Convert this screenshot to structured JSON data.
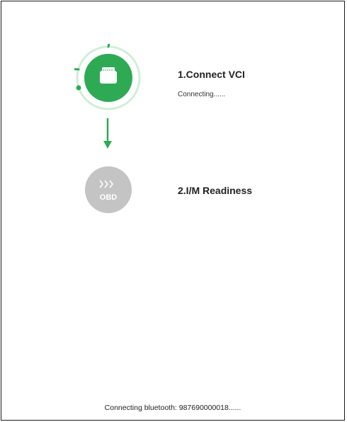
{
  "steps": [
    {
      "title": "1.Connect VCI",
      "status": "Connecting......",
      "icon": "vci-connector-icon",
      "state": "active",
      "color": "#2eaa55"
    },
    {
      "title": "2.I/M Readiness",
      "icon": "obd-icon",
      "icon_text": "OBD",
      "state": "pending",
      "color": "#c4c4c4"
    }
  ],
  "footer": {
    "status": "Connecting bluetooth: 987690000018......"
  },
  "colors": {
    "accent": "#2eaa55",
    "accent_light": "#cfeed8",
    "inactive": "#c4c4c4",
    "text": "#222222"
  }
}
